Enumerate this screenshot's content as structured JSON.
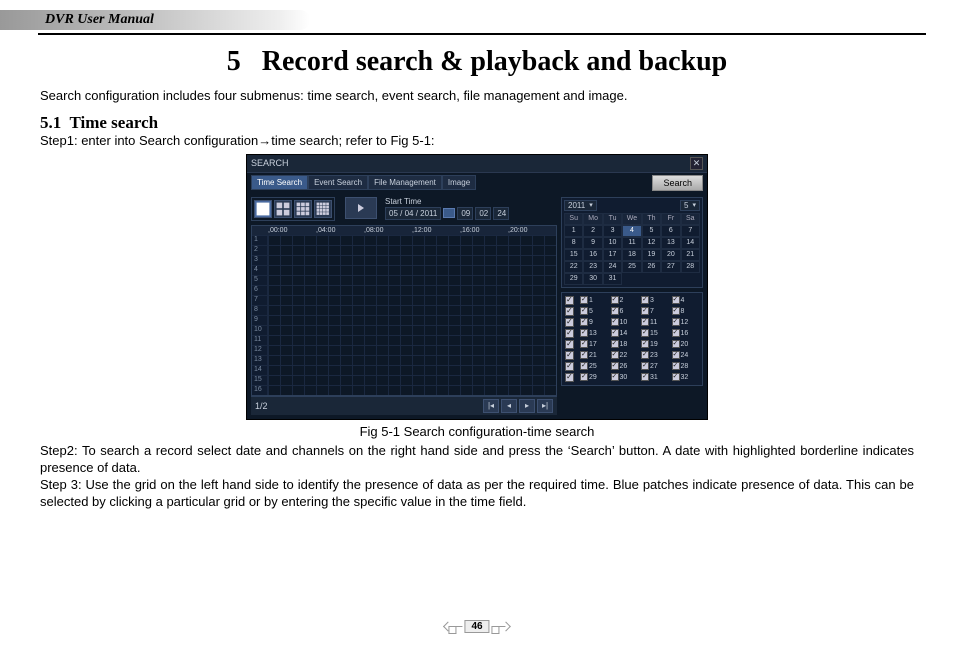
{
  "header": {
    "manual_title": "DVR User Manual"
  },
  "chapter": {
    "number": "5",
    "title": "Record search & playback and backup"
  },
  "intro": "Search configuration includes four submenus: time search, event search, file management and image.",
  "section": {
    "number": "5.1",
    "title": "Time search"
  },
  "steps": {
    "s1": "Step1: enter into Search configuration→time search; refer to Fig 5-1:",
    "s2": "Step2: To search a record select date and channels on the right hand side and press the ‘Search’ button. A date with highlighted borderline indicates presence of data.",
    "s3": "Step 3: Use the grid on the left hand side to identify the presence of data as per the required time. Blue patches indicate presence of data. This can be selected by clicking a particular grid or by entering the specific value in the time field."
  },
  "caption": "Fig 5-1 Search configuration-time search",
  "page_number": "46",
  "dvr": {
    "title": "SEARCH",
    "tabs": [
      "Time Search",
      "Event Search",
      "File Management",
      "Image"
    ],
    "search_btn": "Search",
    "start_time_label": "Start Time",
    "date_value": "05 / 04 / 2011",
    "time_h": "09",
    "time_m": "02",
    "time_s": "24",
    "time_ticks": [
      ",00:00",
      ",04:00",
      ",08:00",
      ",12:00",
      ",16:00",
      ",20:00"
    ],
    "grid_rows": [
      "1",
      "2",
      "3",
      "4",
      "5",
      "6",
      "7",
      "8",
      "9",
      "10",
      "11",
      "12",
      "13",
      "14",
      "15",
      "16"
    ],
    "pager_label": "1/2",
    "calendar": {
      "year": "2011",
      "month": "5",
      "days_hdr": [
        "Su",
        "Mo",
        "Tu",
        "We",
        "Th",
        "Fr",
        "Sa"
      ],
      "cells": [
        {
          "v": "1"
        },
        {
          "v": "2"
        },
        {
          "v": "3"
        },
        {
          "v": "4",
          "today": true
        },
        {
          "v": "5"
        },
        {
          "v": "6"
        },
        {
          "v": "7"
        },
        {
          "v": "8"
        },
        {
          "v": "9"
        },
        {
          "v": "10"
        },
        {
          "v": "11"
        },
        {
          "v": "12"
        },
        {
          "v": "13"
        },
        {
          "v": "14"
        },
        {
          "v": "15"
        },
        {
          "v": "16"
        },
        {
          "v": "17"
        },
        {
          "v": "18"
        },
        {
          "v": "19"
        },
        {
          "v": "20"
        },
        {
          "v": "21"
        },
        {
          "v": "22"
        },
        {
          "v": "23"
        },
        {
          "v": "24"
        },
        {
          "v": "25"
        },
        {
          "v": "26"
        },
        {
          "v": "27"
        },
        {
          "v": "28"
        },
        {
          "v": "29"
        },
        {
          "v": "30"
        },
        {
          "v": "31"
        },
        {
          "v": "",
          "e": true
        },
        {
          "v": "",
          "e": true
        },
        {
          "v": "",
          "e": true
        },
        {
          "v": "",
          "e": true
        }
      ]
    },
    "channels": [
      "1",
      "2",
      "3",
      "4",
      "5",
      "6",
      "7",
      "8",
      "9",
      "10",
      "11",
      "12",
      "13",
      "14",
      "15",
      "16",
      "17",
      "18",
      "19",
      "20",
      "21",
      "22",
      "23",
      "24",
      "25",
      "26",
      "27",
      "28",
      "29",
      "30",
      "31",
      "32"
    ]
  }
}
